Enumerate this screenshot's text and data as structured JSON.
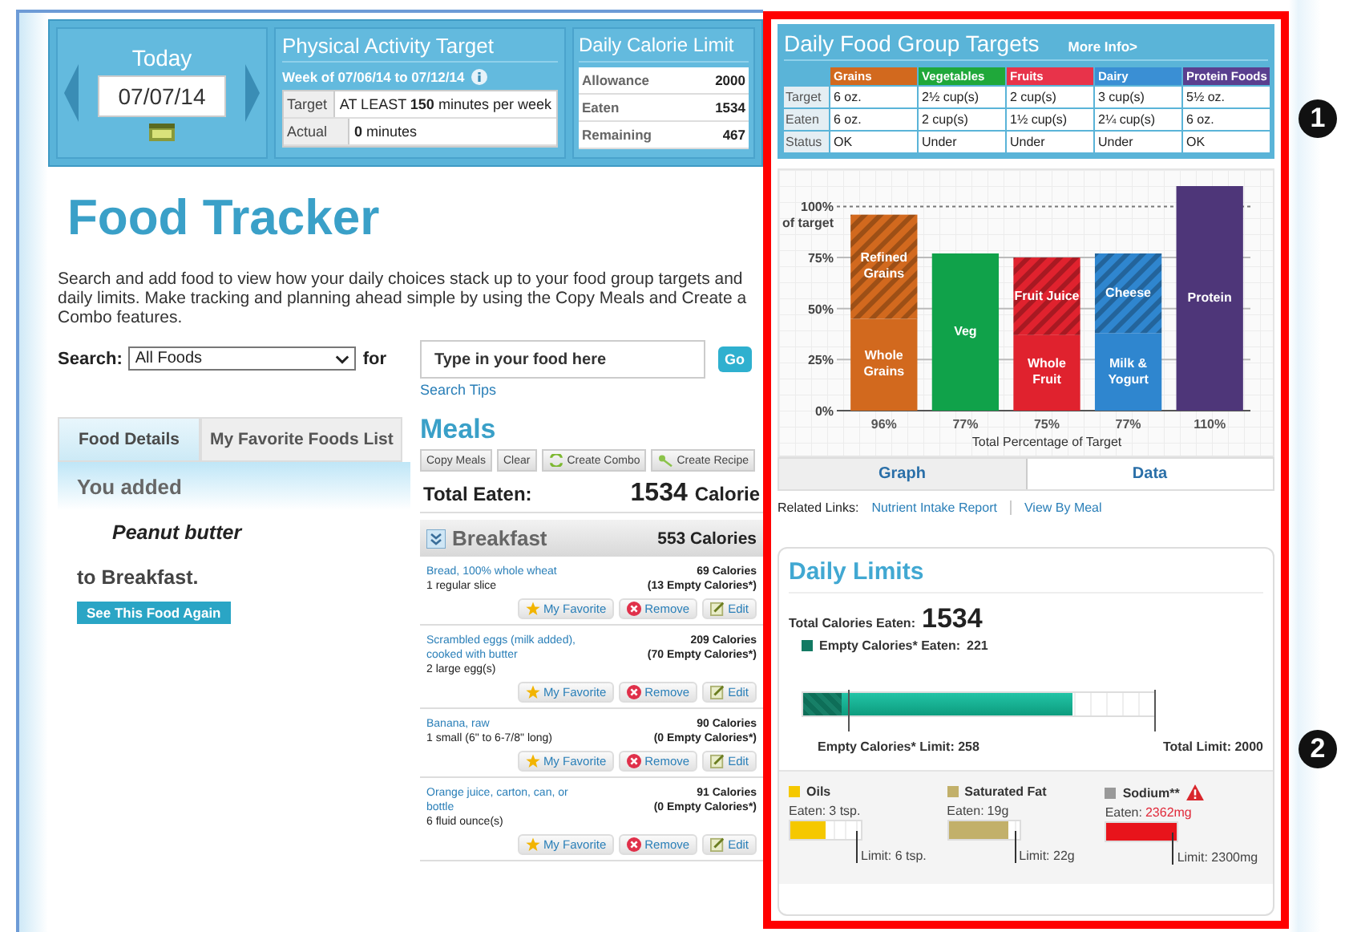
{
  "date_nav": {
    "title": "Today",
    "date": "07/07/14"
  },
  "activity": {
    "title": "Physical Activity Target",
    "week": "Week of 07/06/14 to 07/12/14",
    "rows": [
      {
        "label": "Target",
        "value": "AT LEAST **150** minutes per week"
      },
      {
        "label": "Actual",
        "value": "**0** minutes"
      }
    ]
  },
  "calorie_limit": {
    "title": "Daily Calorie Limit",
    "rows": [
      {
        "label": "Allowance",
        "value": "2000"
      },
      {
        "label": "Eaten",
        "value": "1534"
      },
      {
        "label": "Remaining",
        "value": "467"
      }
    ]
  },
  "page_title": "Food Tracker",
  "intro": "Search and add food to view how your daily choices stack up to your food group targets and daily limits. Make tracking and planning ahead simple by using the Copy Meals and Create a Combo features.",
  "search": {
    "label": "Search:",
    "category": "All Foods",
    "for": "for",
    "placeholder": "Type in your food here",
    "go": "Go",
    "tips": "Search Tips"
  },
  "tabs": [
    {
      "label": "Food Details",
      "selected": true
    },
    {
      "label": "My Favorite Foods List",
      "selected": false
    }
  ],
  "food_details": {
    "lead": "You added",
    "food": "Peanut butter",
    "meal": "to Breakfast.",
    "button": "See This Food Again"
  },
  "meals": {
    "title": "Meals",
    "actions": [
      {
        "label": "Copy Meals",
        "kind": "plain"
      },
      {
        "label": "Clear",
        "kind": "plain"
      },
      {
        "label": "Create Combo",
        "kind": "combo"
      },
      {
        "label": "Create Recipe",
        "kind": "recipe"
      }
    ],
    "total_label": "Total Eaten:",
    "total_value": "1534",
    "total_unit": "Calorie",
    "meal": {
      "name": "Breakfast",
      "calories": "553 Calories",
      "items": [
        {
          "name": "Bread, 100% whole wheat",
          "portion": "1 regular slice",
          "calories": "69 Calories",
          "empty": "(13 Empty Calories*)",
          "actions": [
            "My Favorite",
            "Remove",
            "Edit"
          ]
        },
        {
          "name": "Scrambled eggs (milk added), cooked with butter",
          "portion": "2 large egg(s)",
          "calories": "209 Calories",
          "empty": "(70 Empty Calories*)",
          "actions": [
            "My Favorite",
            "Remove",
            "Edit"
          ]
        },
        {
          "name": "Banana, raw",
          "portion": "1 small (6\" to 6-7/8\" long)",
          "calories": "90 Calories",
          "empty": "(0 Empty Calories*)",
          "actions": [
            "My Favorite",
            "Remove",
            "Edit"
          ]
        },
        {
          "name": "Orange juice, carton, can, or bottle",
          "portion": "6 fluid ounce(s)",
          "calories": "91 Calories",
          "empty": "(0 Empty Calories*)",
          "actions": [
            "My Favorite",
            "Remove",
            "Edit"
          ]
        }
      ]
    }
  },
  "food_groups": {
    "title": "Daily Food Group Targets",
    "more": "More Info>",
    "groups": [
      {
        "name": "Grains",
        "color": "#d2691e"
      },
      {
        "name": "Vegetables",
        "color": "#1fa83a"
      },
      {
        "name": "Fruits",
        "color": "#e8334a"
      },
      {
        "name": "Dairy",
        "color": "#3a8fd4"
      },
      {
        "name": "Protein Foods",
        "color": "#5a3f8f"
      }
    ],
    "rows": [
      {
        "label": "Target",
        "values": [
          "6 oz.",
          "2½ cup(s)",
          "2 cup(s)",
          "3 cup(s)",
          "5½ oz."
        ]
      },
      {
        "label": "Eaten",
        "values": [
          "6 oz.",
          "2 cup(s)",
          "1½ cup(s)",
          "2¼ cup(s)",
          "6 oz."
        ]
      },
      {
        "label": "Status",
        "values": [
          "OK",
          "Under",
          "Under",
          "Under",
          "OK"
        ]
      }
    ],
    "graph": {
      "y_note": "of target",
      "bars": [
        {
          "labels": [
            "Refined Grains",
            "Whole Grains"
          ]
        },
        {
          "labels": [
            "Veg"
          ]
        },
        {
          "labels": [
            "Fruit Juice",
            "Whole Fruit"
          ]
        },
        {
          "labels": [
            "Cheese",
            "Milk & Yogurt"
          ]
        },
        {
          "labels": [
            "Protein"
          ]
        }
      ],
      "chart_data": {
        "type": "bar",
        "stacked": true,
        "grid": true,
        "xlabel": "Total Percentage of Target",
        "categories": [
          "96%",
          "77%",
          "75%",
          "77%",
          "110%"
        ],
        "series": [
          {
            "colors": [
              "#d2691e",
              "#10a24a",
              "#e0222e",
              "#2f86cf",
              "#4e3679"
            ],
            "values": [
              45,
              77,
              37,
              38,
              110
            ]
          },
          {
            "colors": [
              "#d2691e",
              "#10a24a",
              "#e0222e",
              "#2f86cf",
              "#4e3679"
            ],
            "values": [
              51,
              null,
              38,
              39,
              null
            ]
          }
        ],
        "ylim": [
          0,
          110
        ],
        "ref_lines": [
          {
            "axis": "y",
            "value": 100
          }
        ],
        "yticks": [
          {
            "value": 0,
            "label": "0%"
          },
          {
            "value": 25,
            "label": "25%"
          },
          {
            "value": 50,
            "label": "50%"
          },
          {
            "value": 75,
            "label": "75%"
          },
          {
            "value": 100,
            "label": "100%"
          }
        ]
      },
      "views": [
        {
          "label": "Graph",
          "selected": true
        },
        {
          "label": "Data",
          "selected": false
        }
      ]
    },
    "related": {
      "label": "Related Links:",
      "links": [
        "Nutrient Intake Report",
        "View By Meal"
      ]
    }
  },
  "daily_limits": {
    "title": "Daily Limits",
    "total_label": "Total Calories Eaten:",
    "total_value": "1534",
    "empty_legend": "Empty Calories* Eaten:",
    "empty_value": "221",
    "calorie_fill": {
      "level": 0.767
    },
    "empty_fill": {
      "level": 0.11
    },
    "empty_limit": {
      "level": 0.129,
      "label": "Empty Calories* Limit: 258"
    },
    "total_limit": "Total Limit: 2000",
    "nutrients": [
      {
        "name": "Oils",
        "color": "#f5c800",
        "eaten_label": "Eaten:",
        "eaten": "3 tsp.",
        "level": 0.5,
        "limit": "Limit: 6 tsp.",
        "over": false
      },
      {
        "name": "Saturated Fat",
        "color": "#c2b06a",
        "eaten_label": "Eaten:",
        "eaten": "19g",
        "level": 0.86,
        "limit": "Limit: 22g",
        "over": false
      },
      {
        "name": "Sodium**",
        "color": "#999999",
        "eaten_label": "Eaten:",
        "eaten": "2362mg",
        "level": 1,
        "limit": "Limit: 2300mg",
        "over": true
      }
    ]
  },
  "callouts": [
    "1",
    "2"
  ]
}
